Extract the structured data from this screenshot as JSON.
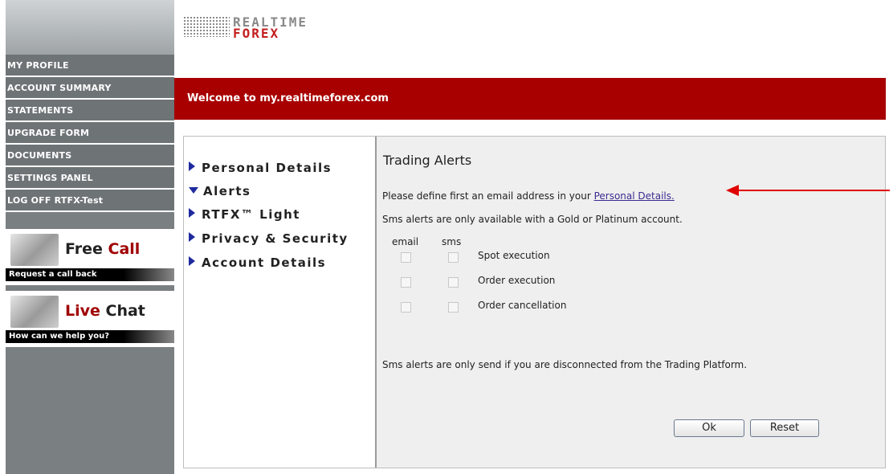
{
  "logo": {
    "line1": "REALTIME",
    "line2": "FOREX"
  },
  "sidebar": {
    "items": [
      {
        "label": "MY PROFILE"
      },
      {
        "label": "ACCOUNT SUMMARY"
      },
      {
        "label": "STATEMENTS"
      },
      {
        "label": "UPGRADE FORM"
      },
      {
        "label": "DOCUMENTS"
      },
      {
        "label": "SETTINGS PANEL"
      },
      {
        "label": "LOG OFF RTFX-Test"
      }
    ],
    "promos": [
      {
        "title_black": "Free ",
        "title_red": "Call",
        "bar": "Request a call back",
        "red_first": false
      },
      {
        "title_red": "Live ",
        "title_black": "Chat",
        "bar": "How can we help you?",
        "red_first": true
      }
    ]
  },
  "welcome": "Welcome to my.realtimeforex.com",
  "menu": {
    "items": [
      {
        "label": "Personal Details",
        "expanded": false
      },
      {
        "label": "Alerts",
        "expanded": true
      },
      {
        "label": "RTFX™ Light",
        "expanded": false
      },
      {
        "label": "Privacy & Security",
        "expanded": false
      },
      {
        "label": "Account Details",
        "expanded": false
      }
    ]
  },
  "panel": {
    "title": "Trading Alerts",
    "email_note_prefix": "Please define first an email address in your ",
    "email_note_link": "Personal Details.",
    "sms_note": "Sms alerts are only available with a Gold or Platinum account.",
    "col_email": "email",
    "col_sms": "sms",
    "rows": [
      {
        "label": "Spot execution"
      },
      {
        "label": "Order execution"
      },
      {
        "label": "Order cancellation"
      }
    ],
    "footer_note": "Sms alerts are only send if you are disconnected from the Trading Platform.",
    "ok_label": "Ok",
    "reset_label": "Reset"
  },
  "colors": {
    "brand_red": "#a80000",
    "sidebar_gray": "#6e7376",
    "arrow": "#e00000",
    "link": "#3b2a90"
  }
}
